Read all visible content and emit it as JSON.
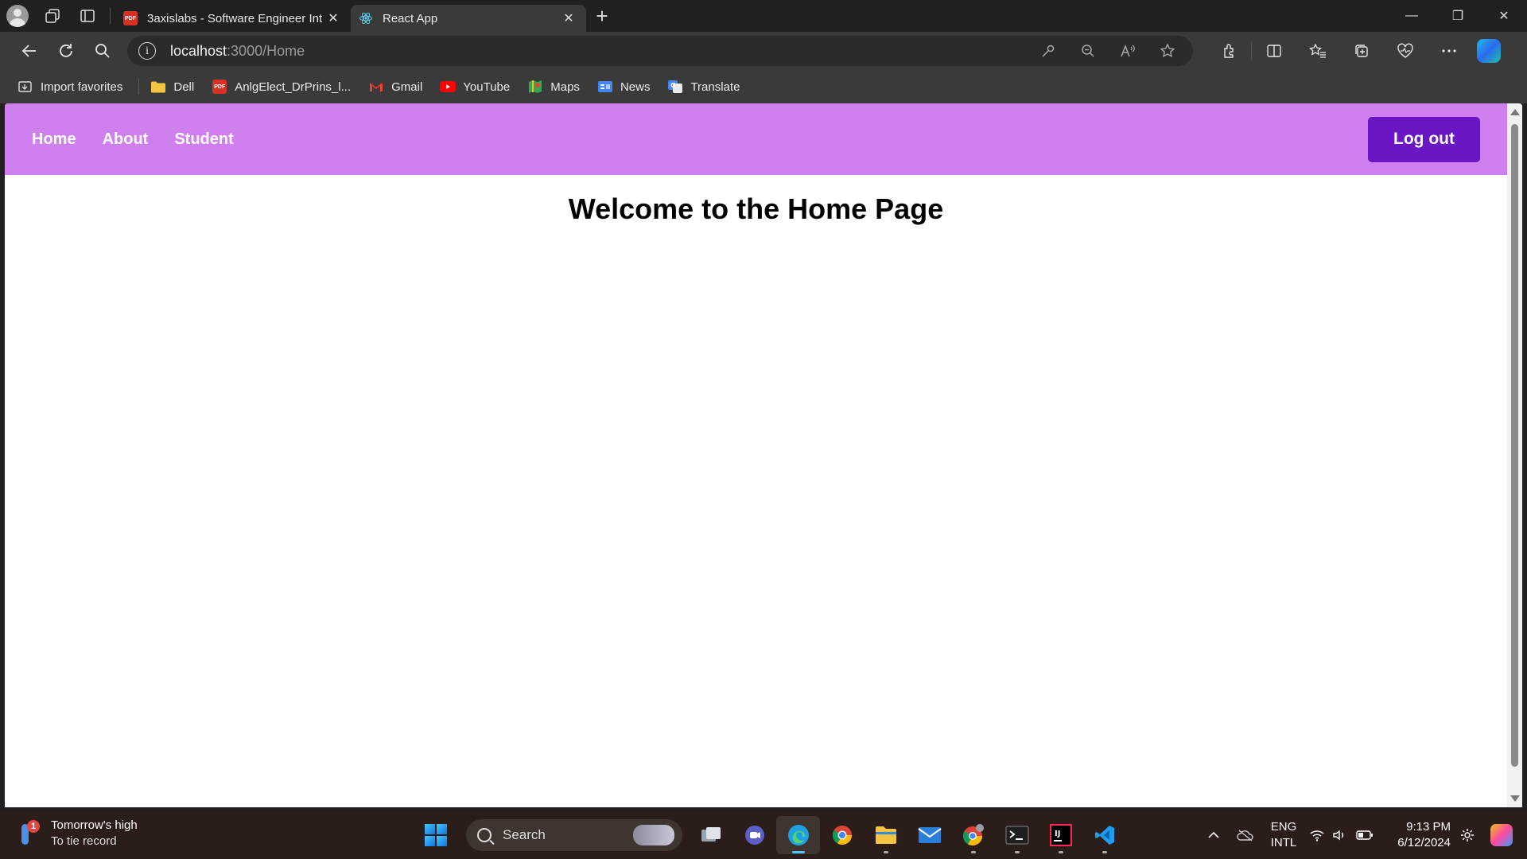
{
  "browser": {
    "tabs": [
      {
        "title": "3axislabs - Software Engineer Int",
        "icon": "pdf-icon",
        "active": false
      },
      {
        "title": "React App",
        "icon": "react-icon",
        "active": true
      }
    ],
    "pdf_icon_text": "PDF",
    "close_glyph": "✕",
    "new_tab_glyph": "+",
    "window_controls": {
      "minimize": "—",
      "restore": "❐",
      "close": "✕"
    },
    "url": {
      "host": "localhost",
      "path": ":3000/Home"
    },
    "info_glyph": "i",
    "favorites": [
      {
        "label": "Import favorites",
        "icon": "import-icon"
      },
      {
        "label": "Dell",
        "icon": "folder-icon"
      },
      {
        "label": "AnlgElect_DrPrins_l...",
        "icon": "pdf-icon"
      },
      {
        "label": "Gmail",
        "icon": "gmail-icon"
      },
      {
        "label": "YouTube",
        "icon": "youtube-icon"
      },
      {
        "label": "Maps",
        "icon": "maps-icon"
      },
      {
        "label": "News",
        "icon": "news-icon"
      },
      {
        "label": "Translate",
        "icon": "translate-icon"
      }
    ]
  },
  "page": {
    "nav": {
      "links": [
        "Home",
        "About",
        "Student"
      ],
      "logout_label": "Log out"
    },
    "heading": "Welcome to the Home Page",
    "colors": {
      "nav_bg": "#cf7fee",
      "logout_bg": "#6a16c4"
    }
  },
  "taskbar": {
    "weather": {
      "title": "Tomorrow's high",
      "subtitle": "To tie record",
      "badge": "1"
    },
    "search_label": "Search",
    "lang": {
      "line1": "ENG",
      "line2": "INTL"
    },
    "clock": {
      "time": "9:13 PM",
      "date": "6/12/2024"
    }
  }
}
